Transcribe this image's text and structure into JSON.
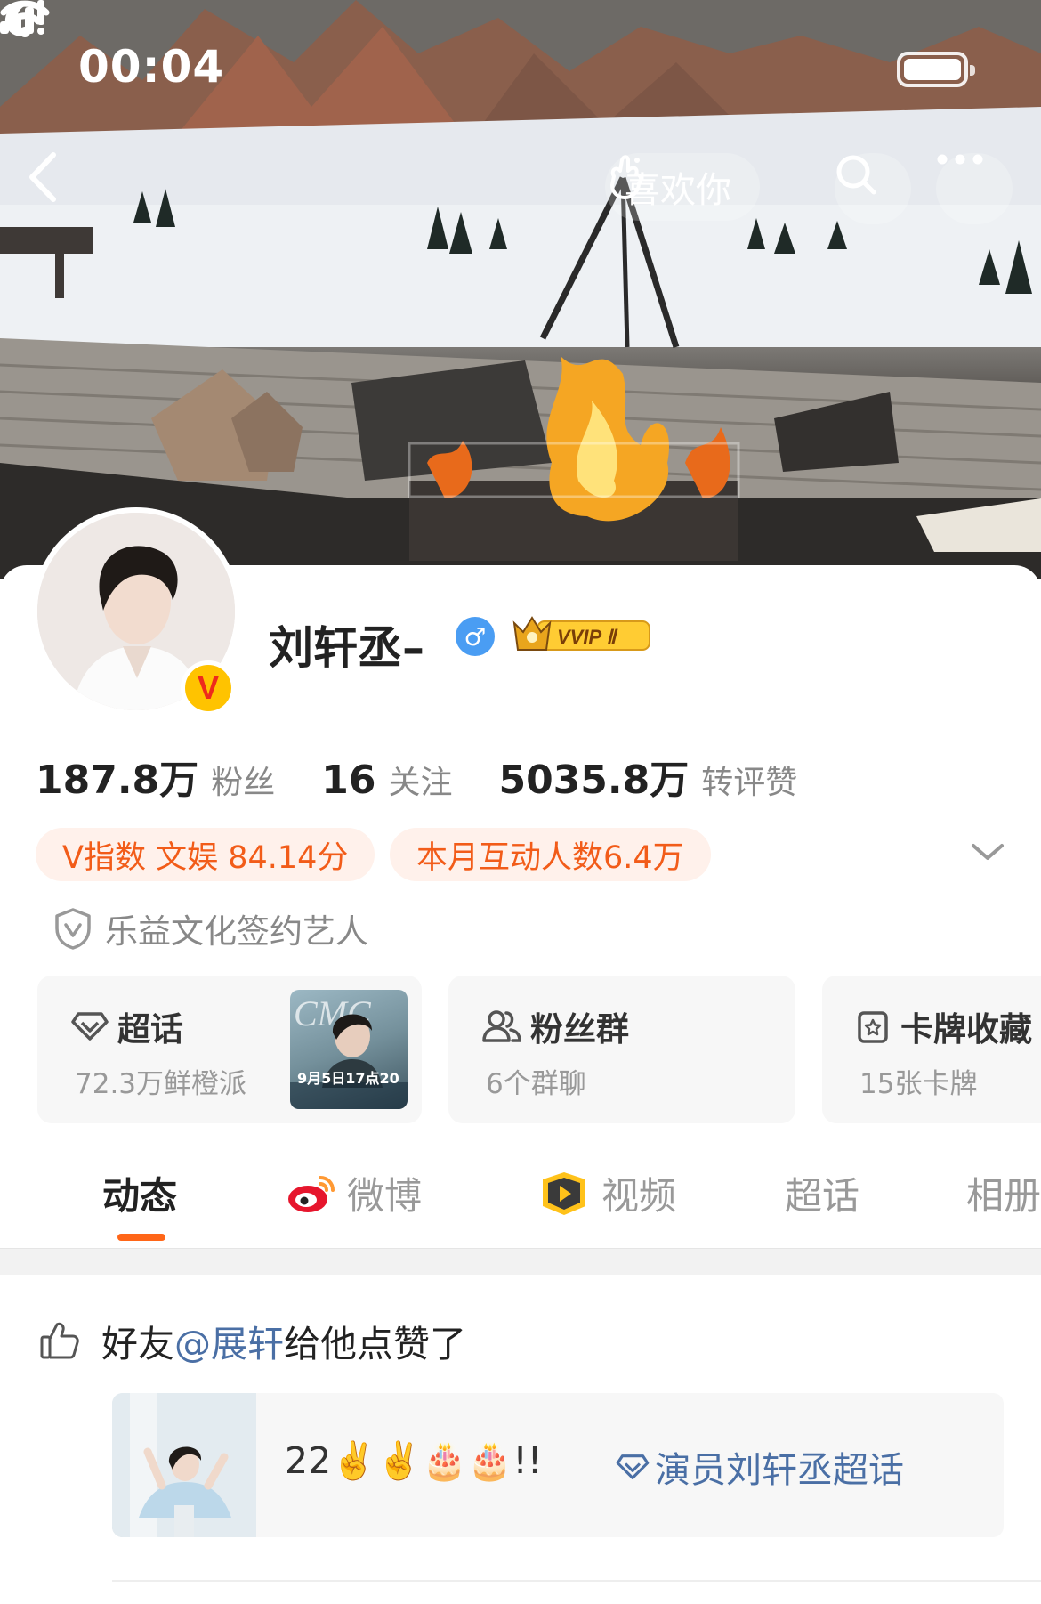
{
  "status_bar": {
    "time": "00:04"
  },
  "header": {
    "like_label": "喜欢你"
  },
  "profile": {
    "name": "刘轩丞–",
    "vvip_label": "VVIP Ⅱ",
    "avatar_badge": "V"
  },
  "stats": [
    {
      "value": "187.8万",
      "label": "粉丝"
    },
    {
      "value": "16",
      "label": "关注"
    },
    {
      "value": "5035.8万",
      "label": "转评赞"
    }
  ],
  "tags": [
    "V指数 文娱 84.14分",
    "本月互动人数6.4万"
  ],
  "certification": "乐益文化签约艺人",
  "modules": [
    {
      "title": "超话",
      "subtitle": "72.3万鲜橙派",
      "icon": "diamond-icon"
    },
    {
      "title": "粉丝群",
      "subtitle": "6个群聊",
      "icon": "group-icon"
    },
    {
      "title": "卡牌收藏",
      "subtitle": "15张卡牌",
      "icon": "card-icon"
    }
  ],
  "supertopic_thumb": {
    "caption": "9月5日17点20"
  },
  "tabs": [
    {
      "label": "动态",
      "icon": ""
    },
    {
      "label": "微博",
      "icon": "weibo-icon"
    },
    {
      "label": "视频",
      "icon": "video-icon"
    },
    {
      "label": "超话",
      "icon": ""
    },
    {
      "label": "相册",
      "icon": ""
    }
  ],
  "feed": {
    "prefix": "好友",
    "mention": "@展轩",
    "suffix": "给他点赞了",
    "post_text": "22✌️✌️🎂🎂!!",
    "topic_link": "演员刘轩丞超话"
  },
  "colors": {
    "accent": "#ff6618",
    "tag_text": "#f25c19",
    "tag_bg": "#fff1eb",
    "link": "#4a6fa5",
    "verified": "#ffc300"
  }
}
